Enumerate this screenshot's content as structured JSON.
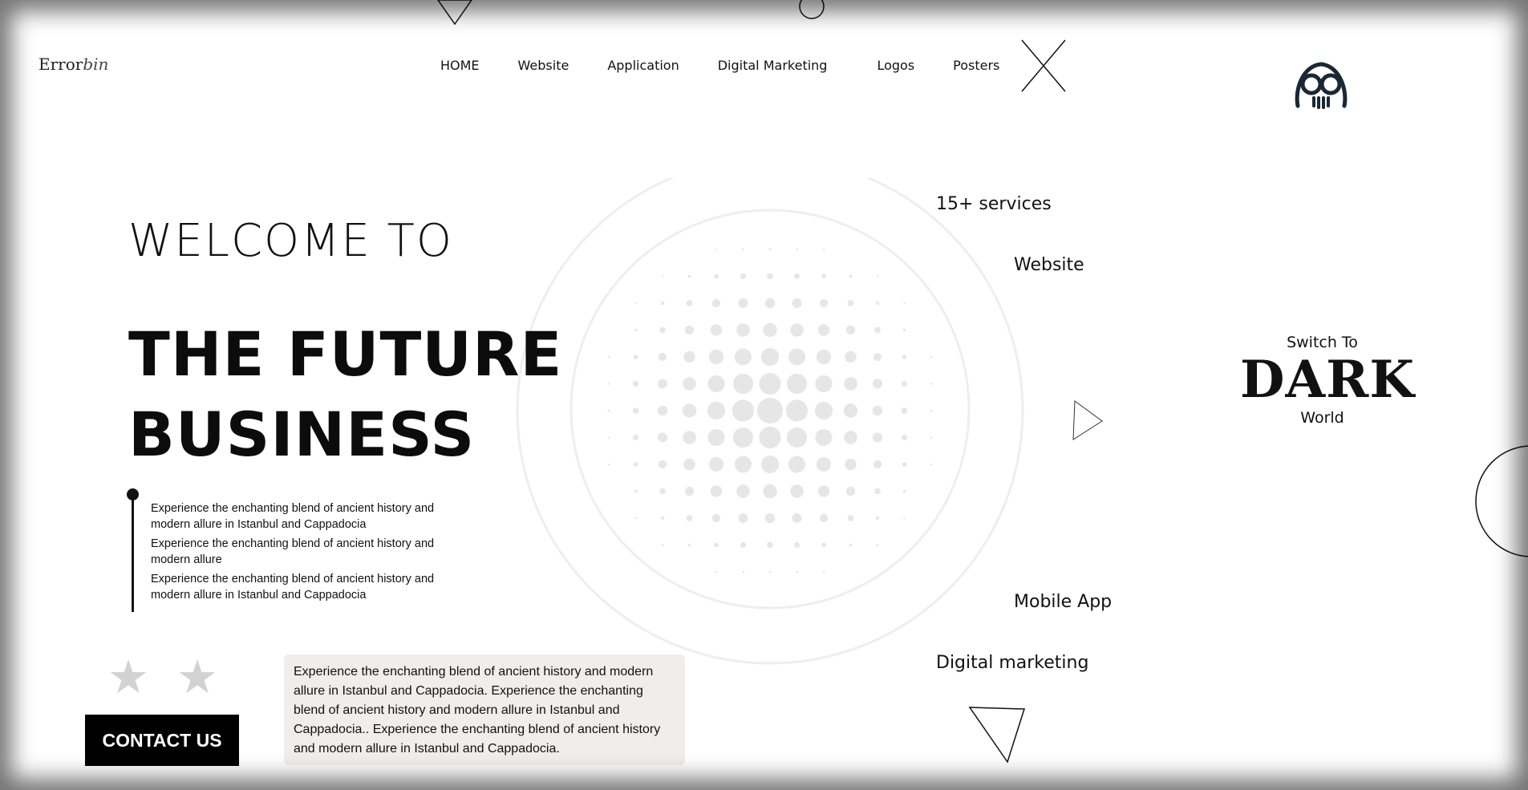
{
  "brand": {
    "name": "Error",
    "name_italic": "bin"
  },
  "nav": {
    "items": [
      {
        "label": "HOME"
      },
      {
        "label": "Website"
      },
      {
        "label": "Application"
      },
      {
        "label": "Digital Marketing"
      },
      {
        "label": "Logos"
      },
      {
        "label": "Posters"
      }
    ],
    "close_icon": "close-icon",
    "mask_icon": "hacker-mask-icon"
  },
  "hero": {
    "welcome": "WELCOME TO",
    "headline_line1": "THE FUTURE",
    "headline_line2": "BUSINESS",
    "bullets": [
      "Experience the enchanting blend of ancient history and modern allure in Istanbul and Cappadocia",
      "Experience the enchanting blend of ancient history and modern allure",
      "Experience the enchanting blend of ancient history and modern allure in Istanbul and Cappadocia"
    ],
    "contact_label": "CONTACT US",
    "stars": [
      "★",
      "★"
    ],
    "card_text": "Experience the enchanting blend of ancient history and modern allure in Istanbul and Cappadocia. Experience the enchanting blend of ancient history and modern allure in Istanbul and Cappadocia.. Experience the enchanting blend of ancient history and modern allure in Istanbul and Cappadocia."
  },
  "services": {
    "count_label": "15+ services",
    "website": "Website",
    "mobile_app": "Mobile App",
    "digital_marketing": "Digital marketing"
  },
  "theme_switch": {
    "top": "Switch To",
    "word": "DARK",
    "bottom": "World"
  },
  "colors": {
    "background": "#ffffff",
    "text": "#111111",
    "card_bg": "#f0eeed",
    "halftone": "#e6e6e6",
    "star": "#d2d2d2"
  }
}
